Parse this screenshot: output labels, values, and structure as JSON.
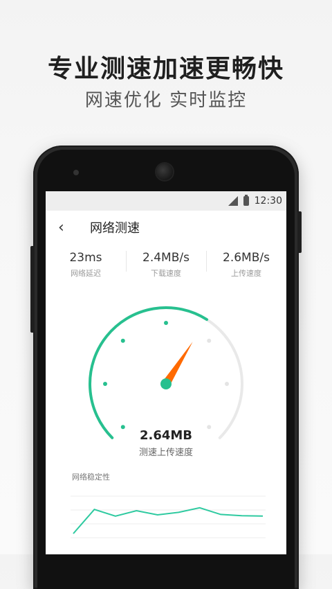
{
  "promo": {
    "title": "专业测速加速更畅快",
    "subtitle": "网速优化  实时监控"
  },
  "statusbar": {
    "time": "12:30"
  },
  "header": {
    "back_icon": "chevron-left-icon",
    "title": "网络测速"
  },
  "stats": [
    {
      "value": "23ms",
      "label": "网络延迟"
    },
    {
      "value": "2.4MB/s",
      "label": "下载速度"
    },
    {
      "value": "2.6MB/s",
      "label": "上传速度"
    }
  ],
  "gauge": {
    "value": "2.64MB",
    "label": "测速上传速度",
    "accent": "#27c08f",
    "needle": "#ff6a00",
    "track": "#e9e9e9",
    "fraction": 0.62
  },
  "stability": {
    "label": "网络稳定性",
    "line_color": "#2ecaa0",
    "grid_color": "#eeeeee",
    "points": [
      0.2,
      0.78,
      0.62,
      0.75,
      0.65,
      0.71,
      0.82,
      0.66,
      0.63,
      0.62
    ]
  }
}
